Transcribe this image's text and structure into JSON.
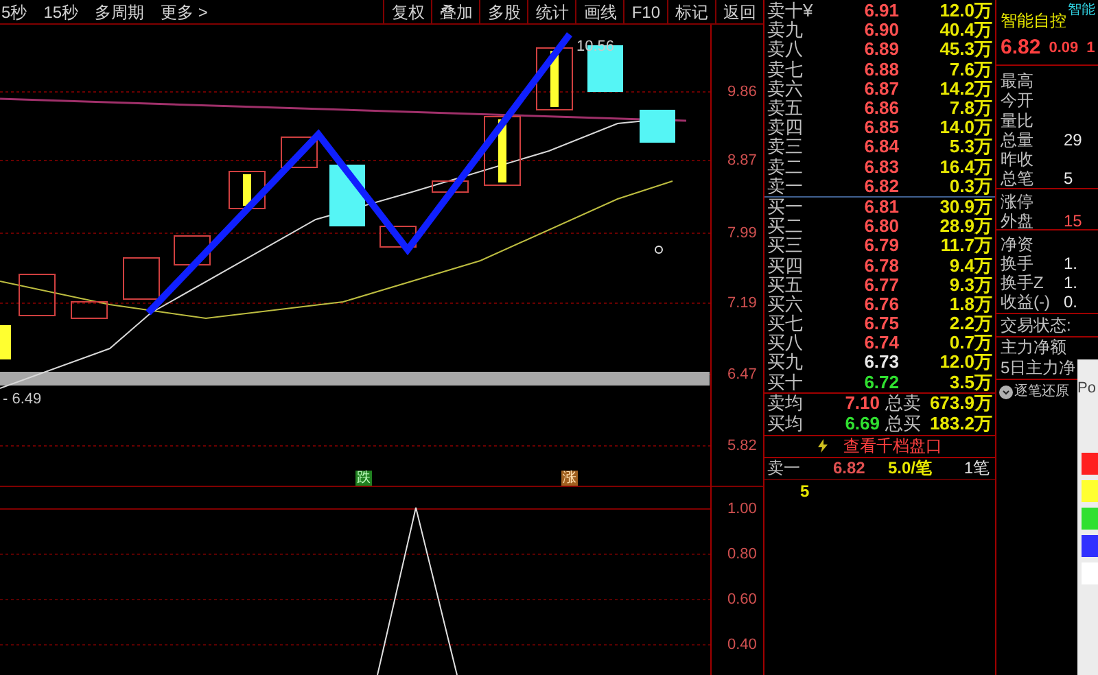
{
  "toolbar": {
    "periods": [
      "5秒",
      "15秒",
      "多周期",
      "更多 >"
    ],
    "buttons": [
      "复权",
      "叠加",
      "多股",
      "统计",
      "画线",
      "F10",
      "标记",
      "返回"
    ]
  },
  "chart": {
    "high_label": "10.56",
    "low_label": "- 6.49",
    "price_axis": [
      "9.86",
      "8.87",
      "7.99",
      "7.19",
      "6.47",
      "5.82"
    ],
    "signals": [
      {
        "label": "跌",
        "kind": "sell"
      },
      {
        "label": "涨",
        "kind": "buy"
      }
    ],
    "indicator_axis": [
      "1.00",
      "0.80",
      "0.60",
      "0.40"
    ]
  },
  "order_book": {
    "asks": [
      {
        "label": "卖十¥",
        "price": "6.91",
        "volume": "12.0万",
        "color": "#ff5050"
      },
      {
        "label": "卖九",
        "price": "6.90",
        "volume": "40.4万",
        "color": "#ff5050"
      },
      {
        "label": "卖八",
        "price": "6.89",
        "volume": "45.3万",
        "color": "#ff5050"
      },
      {
        "label": "卖七",
        "price": "6.88",
        "volume": "7.6万",
        "color": "#ff5050"
      },
      {
        "label": "卖六",
        "price": "6.87",
        "volume": "14.2万",
        "color": "#ff5050"
      },
      {
        "label": "卖五",
        "price": "6.86",
        "volume": "7.8万",
        "color": "#ff5050"
      },
      {
        "label": "卖四",
        "price": "6.85",
        "volume": "14.0万",
        "color": "#ff5050"
      },
      {
        "label": "卖三",
        "price": "6.84",
        "volume": "5.3万",
        "color": "#ff5050"
      },
      {
        "label": "卖二",
        "price": "6.83",
        "volume": "16.4万",
        "color": "#ff5050"
      },
      {
        "label": "卖一",
        "price": "6.82",
        "volume": "0.3万",
        "color": "#ff5050"
      }
    ],
    "bids": [
      {
        "label": "买一",
        "price": "6.81",
        "volume": "30.9万",
        "color": "#ff5050"
      },
      {
        "label": "买二",
        "price": "6.80",
        "volume": "28.9万",
        "color": "#ff5050"
      },
      {
        "label": "买三",
        "price": "6.79",
        "volume": "11.7万",
        "color": "#ff5050"
      },
      {
        "label": "买四",
        "price": "6.78",
        "volume": "9.4万",
        "color": "#ff5050"
      },
      {
        "label": "买五",
        "price": "6.77",
        "volume": "9.3万",
        "color": "#ff5050"
      },
      {
        "label": "买六",
        "price": "6.76",
        "volume": "1.8万",
        "color": "#ff5050"
      },
      {
        "label": "买七",
        "price": "6.75",
        "volume": "2.2万",
        "color": "#ff5050"
      },
      {
        "label": "买八",
        "price": "6.74",
        "volume": "0.7万",
        "color": "#ff5050"
      },
      {
        "label": "买九",
        "price": "6.73",
        "volume": "12.0万",
        "color": "#e8e8e8"
      },
      {
        "label": "买十",
        "price": "6.72",
        "volume": "3.5万",
        "color": "#30e030"
      }
    ],
    "summary": [
      {
        "label": "卖均",
        "price": "7.10",
        "color": "#ff5050",
        "total_label": "总卖",
        "total": "673.9万"
      },
      {
        "label": "买均",
        "price": "6.69",
        "color": "#30e030",
        "total_label": "总买",
        "total": "183.2万"
      }
    ],
    "depth_link": "查看千档盘口",
    "tick": {
      "label": "卖一",
      "price": "6.82",
      "size": "5.0/笔",
      "count": "1笔",
      "volume": "5"
    }
  },
  "quote": {
    "name": "智能自控",
    "tag": "智能",
    "price": "6.82",
    "change": "0.09",
    "percent": "1",
    "stats": [
      {
        "label": "最高"
      },
      {
        "label": "今开"
      },
      {
        "label": "量比"
      },
      {
        "label": "总量",
        "value": "29",
        "color": "#e8e8e8"
      },
      {
        "label": "昨收"
      },
      {
        "label": "总笔",
        "value": "5",
        "color": "#e8e8e8"
      },
      {
        "label": "涨停"
      },
      {
        "label": "外盘",
        "value": "15",
        "color": "#ff5050"
      },
      {
        "label": "净资"
      },
      {
        "label": "换手",
        "value": "1.",
        "color": "#e8e8e8"
      },
      {
        "label": "换手Z",
        "value": "1.",
        "color": "#e8e8e8"
      },
      {
        "label": "收益(-)",
        "value": "0.",
        "color": "#e8e8e8"
      }
    ],
    "status_label": "交易状态:",
    "fund_labels": [
      "主力净额",
      "5日主力净"
    ],
    "replay_button": "逐笔还原"
  },
  "tool_panel": {
    "title": "Po"
  }
}
